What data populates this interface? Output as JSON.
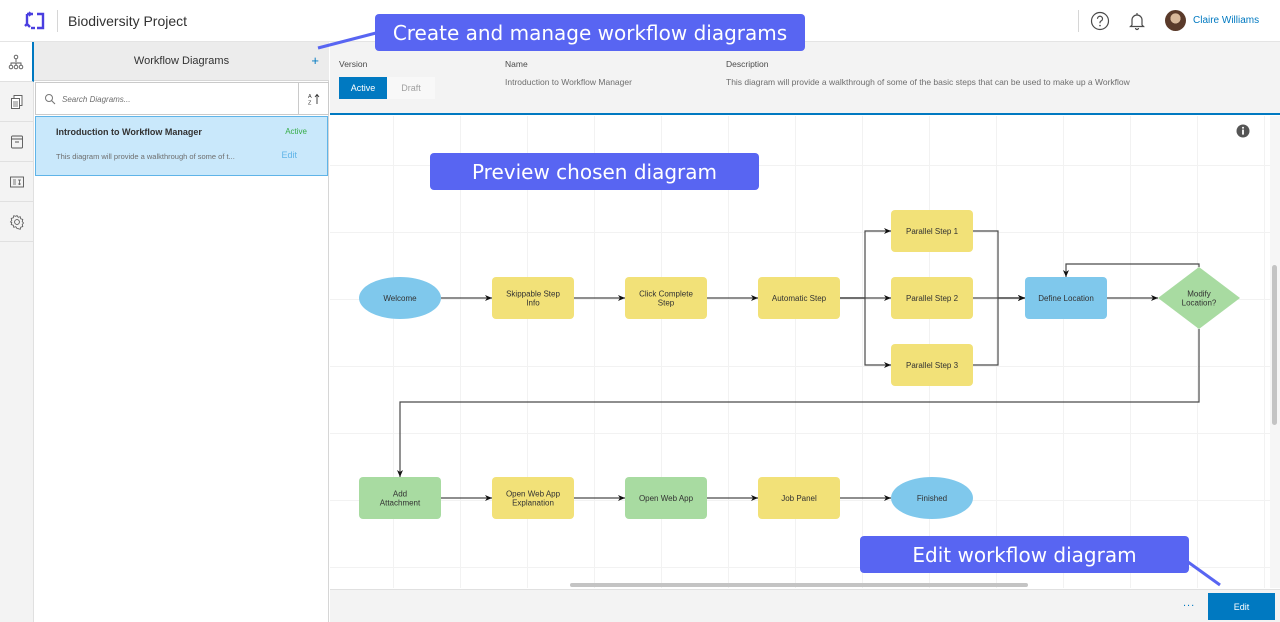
{
  "header": {
    "app_logo": "workflow-manager-logo",
    "project_title": "Biodiversity Project",
    "help_icon": "help-circle-icon",
    "notifications_icon": "bell-icon",
    "user_name": "Claire Williams"
  },
  "rail": {
    "items": [
      {
        "name": "workflow-diagrams",
        "icon": "diagram-icon",
        "active": true
      },
      {
        "name": "job-templates",
        "icon": "documents-icon",
        "active": false
      },
      {
        "name": "lookup-tables",
        "icon": "archive-icon",
        "active": false
      },
      {
        "name": "extended-properties",
        "icon": "table-icon",
        "active": false
      },
      {
        "name": "settings",
        "icon": "gear-icon",
        "active": false
      }
    ]
  },
  "panel": {
    "title": "Workflow Diagrams",
    "add_label": "+",
    "search_placeholder": "Search Diagrams...",
    "sort_label": "A↓Z",
    "items": [
      {
        "name": "Introduction to Workflow Manager",
        "status": "Active",
        "description": "This diagram will provide a walkthrough of some of t...",
        "edit_label": "Edit"
      }
    ]
  },
  "details": {
    "version_label": "Version",
    "version_options": [
      "Active",
      "Draft"
    ],
    "version_selected": "Active",
    "name_label": "Name",
    "name_value": "Introduction to Workflow Manager",
    "description_label": "Description",
    "description_value": "This diagram will provide a walkthrough of some of the basic steps that can be used to make up a Workflow"
  },
  "diagram": {
    "colors": {
      "start_end": "#7fc8ec",
      "manual_step": "#f2e178",
      "automatic_step": "#a8dba1",
      "question": "#a8dba1",
      "connector": "#4a4a4a"
    },
    "nodes": [
      {
        "id": "welcome",
        "label": [
          "Welcome"
        ],
        "type": "start_end"
      },
      {
        "id": "skippable",
        "label": [
          "Skippable Step",
          "Info"
        ],
        "type": "manual_step"
      },
      {
        "id": "click-complete",
        "label": [
          "Click Complete",
          "Step"
        ],
        "type": "manual_step"
      },
      {
        "id": "automatic",
        "label": [
          "Automatic Step"
        ],
        "type": "manual_step"
      },
      {
        "id": "parallel-1",
        "label": [
          "Parallel Step 1"
        ],
        "type": "manual_step"
      },
      {
        "id": "parallel-2",
        "label": [
          "Parallel Step 2"
        ],
        "type": "manual_step"
      },
      {
        "id": "parallel-3",
        "label": [
          "Parallel Step 3"
        ],
        "type": "manual_step"
      },
      {
        "id": "define-location",
        "label": [
          "Define Location"
        ],
        "type": "start_end_rect"
      },
      {
        "id": "modify-location",
        "label": [
          "Modify",
          "Location?"
        ],
        "type": "question"
      },
      {
        "id": "add-attachment",
        "label": [
          "Add",
          "Attachment"
        ],
        "type": "automatic_step"
      },
      {
        "id": "open-web-app-explanation",
        "label": [
          "Open Web App",
          "Explanation"
        ],
        "type": "manual_step"
      },
      {
        "id": "open-web-app",
        "label": [
          "Open Web App"
        ],
        "type": "automatic_step"
      },
      {
        "id": "job-panel",
        "label": [
          "Job Panel"
        ],
        "type": "manual_step"
      },
      {
        "id": "finished",
        "label": [
          "Finished"
        ],
        "type": "start_end"
      }
    ],
    "edges": [
      [
        "welcome",
        "skippable"
      ],
      [
        "skippable",
        "click-complete"
      ],
      [
        "click-complete",
        "automatic"
      ],
      [
        "automatic",
        "parallel-1"
      ],
      [
        "automatic",
        "parallel-2"
      ],
      [
        "automatic",
        "parallel-3"
      ],
      [
        "parallel-1",
        "define-location"
      ],
      [
        "parallel-2",
        "define-location"
      ],
      [
        "parallel-3",
        "define-location"
      ],
      [
        "define-location",
        "modify-location"
      ],
      [
        "modify-location",
        "define-location"
      ],
      [
        "modify-location",
        "add-attachment"
      ],
      [
        "add-attachment",
        "open-web-app-explanation"
      ],
      [
        "open-web-app-explanation",
        "open-web-app"
      ],
      [
        "open-web-app",
        "job-panel"
      ],
      [
        "job-panel",
        "finished"
      ]
    ],
    "info_icon": "info-icon"
  },
  "footer": {
    "more_label": "...",
    "edit_label": "Edit"
  },
  "callouts": {
    "manage": "Create and manage workflow diagrams",
    "preview": "Preview chosen diagram",
    "edit": "Edit workflow diagram"
  }
}
